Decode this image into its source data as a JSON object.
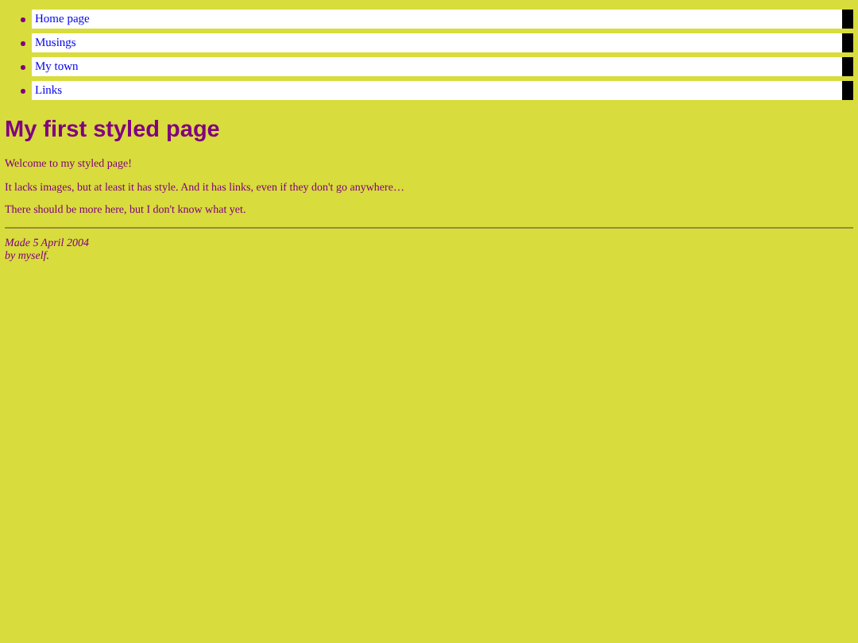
{
  "navigation": [
    {
      "label": "Home page"
    },
    {
      "label": "Musings"
    },
    {
      "label": "My town"
    },
    {
      "label": "Links"
    }
  ],
  "heading": "My first styled page",
  "paragraphs": [
    "Welcome to my styled page!",
    "It lacks images, but at least it has style. And it has links, even if they don't go anywhere…",
    "There should be more here, but I don't know what yet."
  ],
  "footer": {
    "date": "Made 5 April 2004",
    "author": "by myself."
  }
}
